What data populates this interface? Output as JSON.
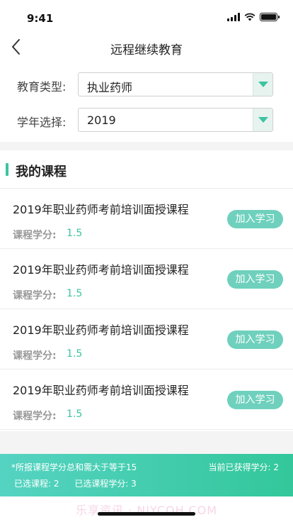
{
  "status_bar": {
    "time": "9:41"
  },
  "nav": {
    "title": "远程继续教育"
  },
  "filters": {
    "education_type": {
      "label": "教育类型:",
      "value": "执业药师"
    },
    "year": {
      "label": "学年选择:",
      "value": "2019"
    }
  },
  "courses": {
    "section_title": "我的课程",
    "credit_label": "课程学分:",
    "join_label": "加入学习",
    "items": [
      {
        "name": "2019年职业药师考前培训面授课程",
        "credit": "1.5"
      },
      {
        "name": "2019年职业药师考前培训面授课程",
        "credit": "1.5"
      },
      {
        "name": "2019年职业药师考前培训面授课程",
        "credit": "1.5"
      },
      {
        "name": "2019年职业药师考前培训面授课程",
        "credit": "1.5"
      }
    ]
  },
  "summary": {
    "note": "*所报课程学分总和需大于等于15",
    "earned": "当前已获得学分: 2",
    "selected_courses": "已选课程: 2",
    "selected_credits": "已选课程学分: 3"
  },
  "watermark": "乐享资讯 · NIYCOH.COM",
  "colors": {
    "accent": "#3cc4a2",
    "button": "#6fd1bd"
  }
}
